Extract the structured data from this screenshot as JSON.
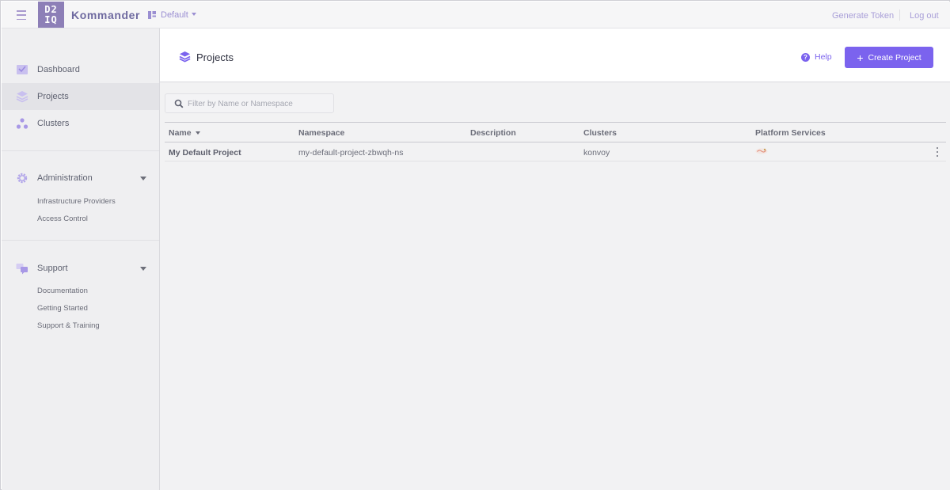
{
  "header": {
    "logo_line1": "D2",
    "logo_line2": "IQ",
    "app_name": "Kommander",
    "workspace": "Default",
    "generate_token": "Generate Token",
    "logout": "Log out"
  },
  "sidebar": {
    "items": [
      {
        "label": "Dashboard",
        "icon": "dashboard-icon"
      },
      {
        "label": "Projects",
        "icon": "projects-icon",
        "active": true
      },
      {
        "label": "Clusters",
        "icon": "clusters-icon"
      }
    ],
    "administration": {
      "label": "Administration",
      "icon": "gear-icon",
      "items": [
        "Infrastructure Providers",
        "Access Control"
      ]
    },
    "support": {
      "label": "Support",
      "icon": "support-icon",
      "items": [
        "Documentation",
        "Getting Started",
        "Support & Training"
      ]
    }
  },
  "page": {
    "title": "Projects",
    "help": "Help",
    "create_button": "Create Project"
  },
  "search": {
    "placeholder": "Filter by Name or Namespace",
    "value": ""
  },
  "table": {
    "columns": [
      "Name",
      "Namespace",
      "Description",
      "Clusters",
      "Platform Services"
    ],
    "sort_column": "Name",
    "rows": [
      {
        "name": "My Default Project",
        "namespace": "my-default-project-zbwqh-ns",
        "description": "",
        "clusters": "konvoy",
        "platform_services_icon": "service-logo-icon"
      }
    ]
  },
  "colors": {
    "accent": "#7b63ee",
    "sidebar_bg": "#efeff1",
    "content_bg": "#f2f2f3",
    "logo_bg": "#8d7fb7"
  }
}
